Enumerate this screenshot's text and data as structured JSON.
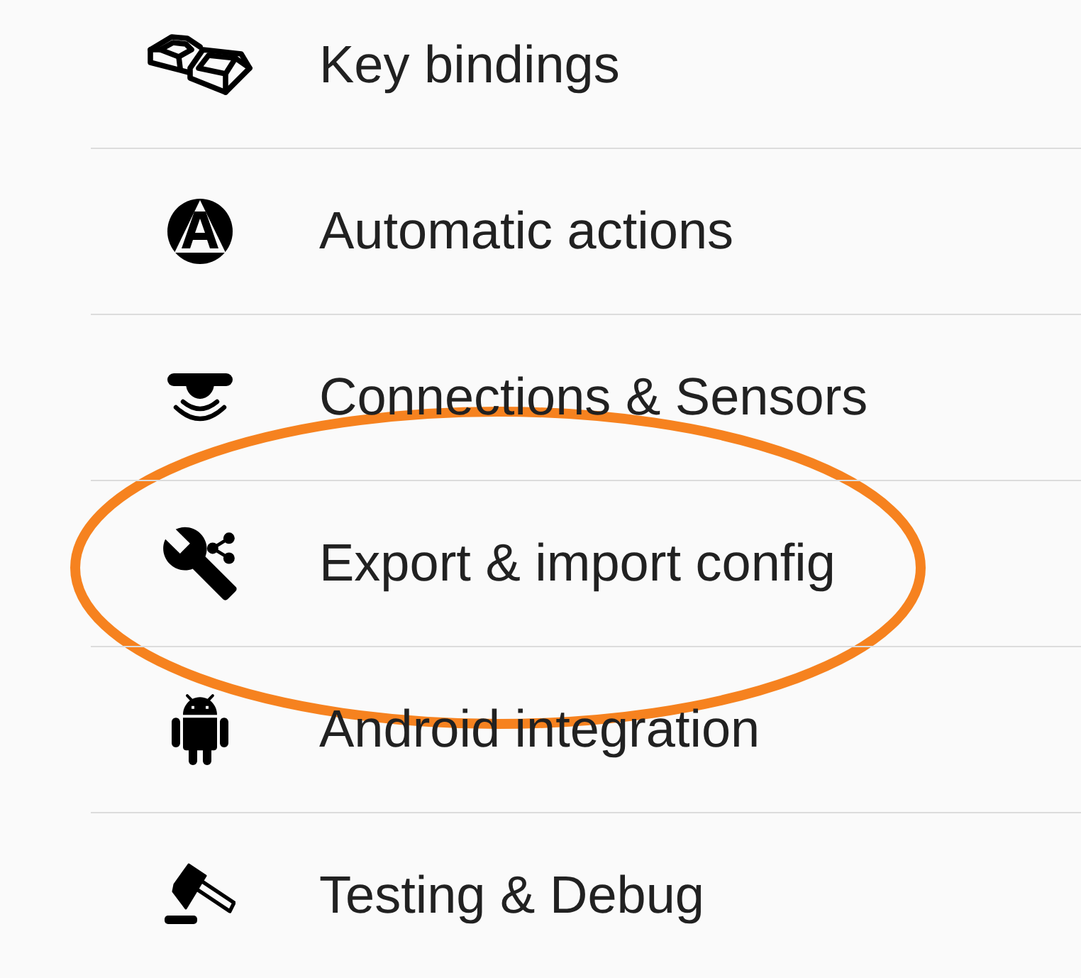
{
  "items": [
    {
      "kind": "keys",
      "label": "Key bindings",
      "highlighted": false
    },
    {
      "kind": "automatic",
      "label": "Automatic actions",
      "highlighted": false
    },
    {
      "kind": "connections",
      "label": "Connections & Sensors",
      "highlighted": false
    },
    {
      "kind": "export",
      "label": "Export & import config",
      "highlighted": true
    },
    {
      "kind": "android",
      "label": "Android integration",
      "highlighted": false
    },
    {
      "kind": "debug",
      "label": "Testing & Debug",
      "highlighted": false
    }
  ]
}
